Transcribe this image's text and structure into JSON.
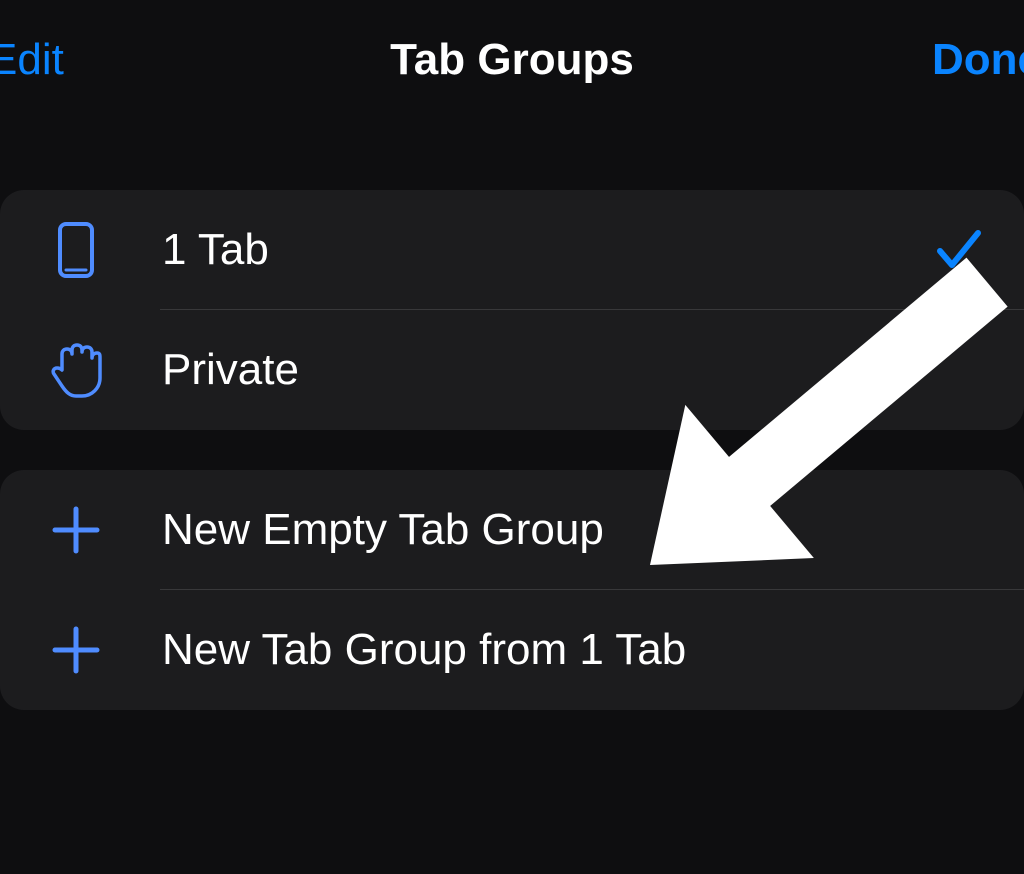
{
  "header": {
    "edit_label": "Edit",
    "title": "Tab Groups",
    "done_label": "Done"
  },
  "section1": {
    "items": [
      {
        "label": "1 Tab",
        "selected": true
      },
      {
        "label": "Private",
        "selected": false
      }
    ]
  },
  "section2": {
    "items": [
      {
        "label": "New Empty Tab Group"
      },
      {
        "label": "New Tab Group from 1 Tab"
      }
    ]
  },
  "colors": {
    "accent": "#0a84ff",
    "background": "#0e0e10",
    "cell": "#1c1c1e"
  }
}
